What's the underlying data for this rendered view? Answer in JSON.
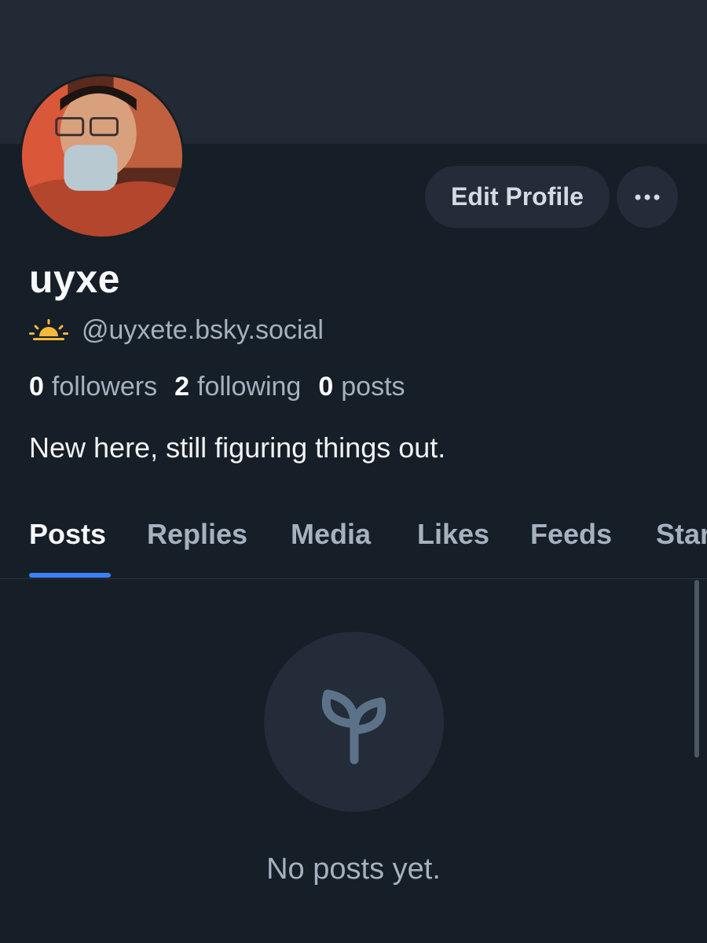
{
  "profile": {
    "display_name": "uyxe",
    "handle": "@uyxete.bsky.social",
    "bio": "New here, still figuring things out.",
    "handle_icon": "sunrise-emoji",
    "avatar_icon": "user-avatar-photo"
  },
  "actions": {
    "edit_profile_label": "Edit Profile",
    "more_icon": "ellipsis-icon"
  },
  "stats": {
    "followers": {
      "count": "0",
      "label": "followers"
    },
    "following": {
      "count": "2",
      "label": "following"
    },
    "posts": {
      "count": "0",
      "label": "posts"
    }
  },
  "tabs": [
    {
      "label": "Posts",
      "active": true
    },
    {
      "label": "Replies",
      "active": false
    },
    {
      "label": "Media",
      "active": false
    },
    {
      "label": "Likes",
      "active": false
    },
    {
      "label": "Feeds",
      "active": false
    },
    {
      "label": "Starter Packs",
      "active": false
    }
  ],
  "empty_state": {
    "icon": "seedling-icon",
    "message": "No posts yet."
  },
  "colors": {
    "background": "#161e27",
    "banner": "#222a35",
    "accent": "#3b82f6",
    "muted_text": "#a5b1be",
    "button_bg": "#232c38"
  }
}
